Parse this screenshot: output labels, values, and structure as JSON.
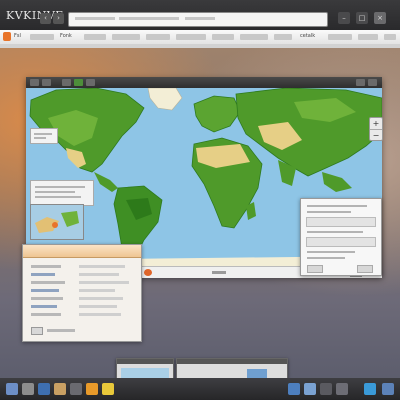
{
  "browser": {
    "title": "KVKINVE",
    "nav": {
      "back_glyph": "‹",
      "forward_glyph": "›"
    },
    "window_controls": [
      "–",
      "□",
      "×"
    ],
    "bookmark_labels": [
      "Fsl",
      "Fonk",
      "cetalk"
    ]
  },
  "map": {
    "zoom": {
      "in_label": "+",
      "out_label": "−"
    }
  },
  "colors": {
    "ocean": "#8ec5e6",
    "land": "#4f9a2a",
    "land_dark": "#2e7a1e",
    "desert": "#e6cf86",
    "ice": "#f3eed6",
    "accent": "#e8742a"
  },
  "icons": [
    "logo-icon",
    "back-icon",
    "forward-icon",
    "map-marker-icon",
    "zoom-in-icon",
    "zoom-out-icon",
    "dock-app-icon"
  ]
}
